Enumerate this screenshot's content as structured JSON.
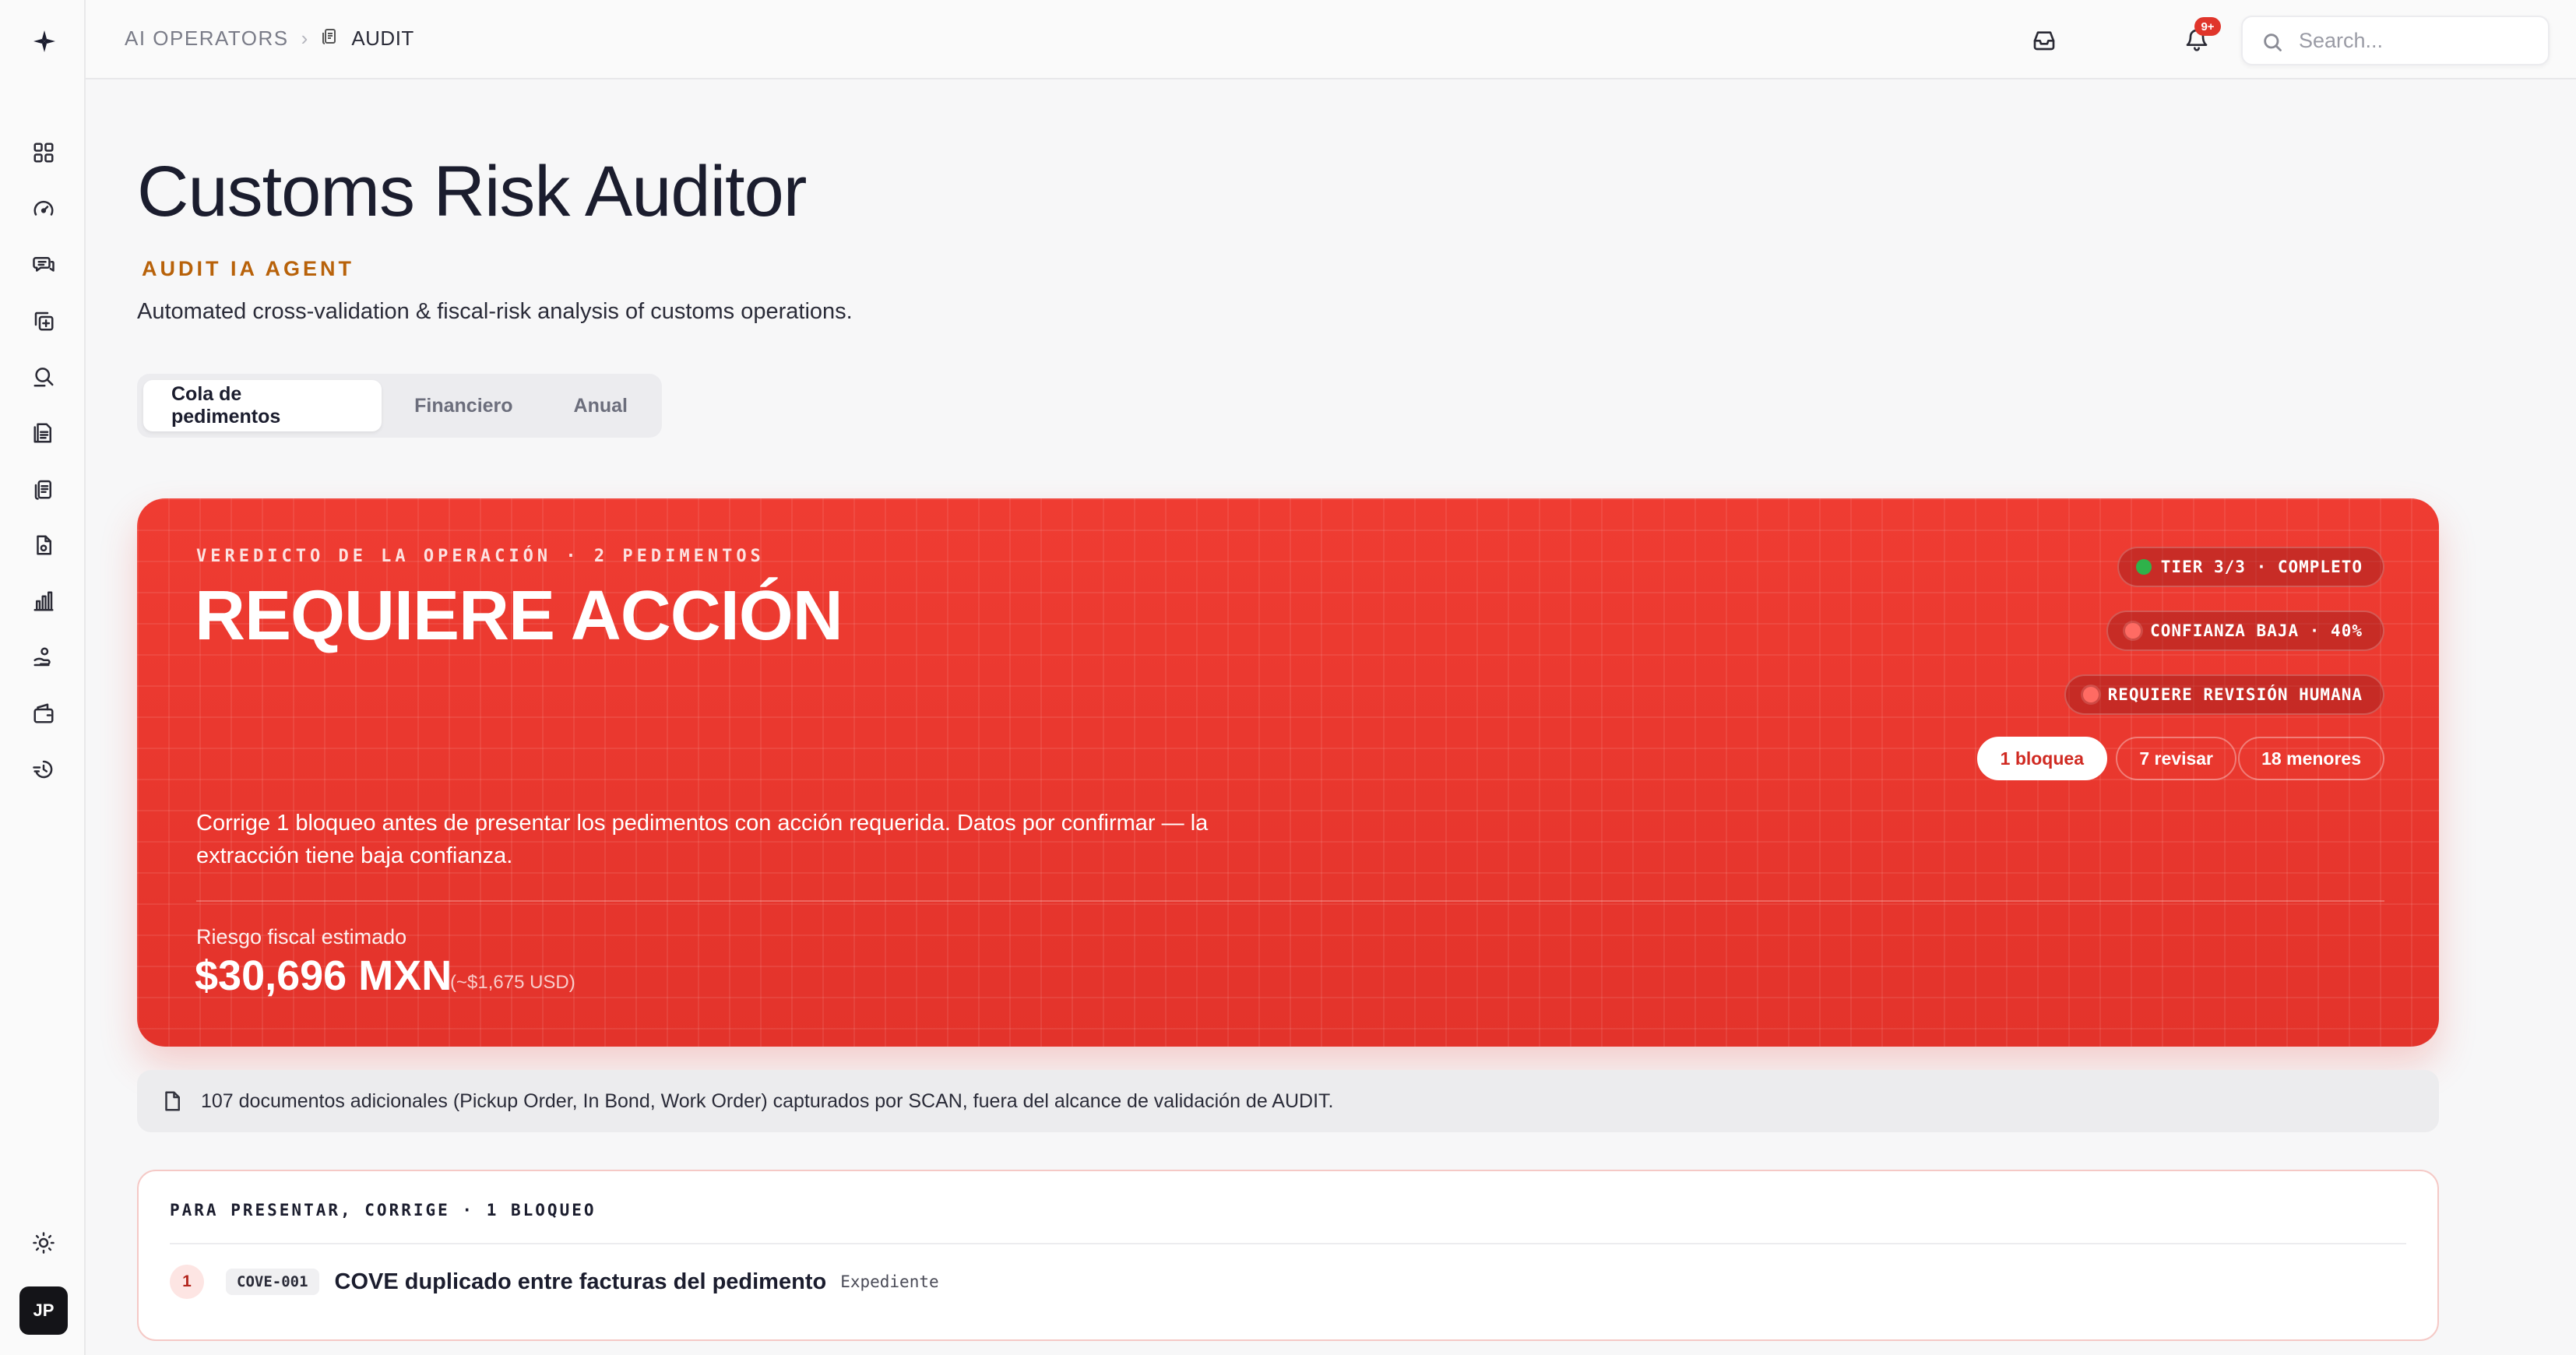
{
  "breadcrumb": {
    "root": "AI OPERATORS",
    "current": "AUDIT"
  },
  "notifications": {
    "badge": "9+"
  },
  "search": {
    "placeholder": "Search..."
  },
  "sidebar": {
    "icons": [
      "dashboard-icon",
      "gauge-icon",
      "chat-icon",
      "copy-plus-icon",
      "search-review-icon",
      "document-icon",
      "clipboard-icon",
      "file-check-icon",
      "bar-chart-icon",
      "hand-coin-icon",
      "wallet-icon",
      "history-icon"
    ],
    "user_initials": "JP"
  },
  "header": {
    "title": "Customs Risk Auditor",
    "subtitle": "AUDIT IA AGENT",
    "description": "Automated cross-validation & fiscal-risk analysis of customs operations."
  },
  "tabs": [
    {
      "label": "Cola de pedimentos",
      "active": true
    },
    {
      "label": "Financiero",
      "active": false
    },
    {
      "label": "Anual",
      "active": false
    }
  ],
  "verdict": {
    "eyebrow": "VEREDICTO DE LA OPERACIÓN · 2 PEDIMENTOS",
    "title": "REQUIERE ACCIÓN",
    "pills": [
      "TIER 3/3 · COMPLETO",
      "CONFIANZA BAJA · 40%",
      "REQUIERE REVISIÓN HUMANA"
    ],
    "counts": [
      "1 bloquea",
      "7 revisar",
      "18 menores"
    ],
    "summary": "Corrige 1 bloqueo antes de presentar los pedimentos con acción requerida. Datos por confirmar — la extracción tiene baja confianza.",
    "risk_label": "Riesgo fiscal estimado",
    "risk_amount": "$30,696 MXN",
    "risk_usd": "(~$1,675 USD)",
    "colors": {
      "card": "#e8352c",
      "ok_dot": "#2fb24a",
      "alert_dot": "#ff6b63"
    }
  },
  "info": {
    "text": "107 documentos adicionales (Pickup Order, In Bond, Work Order) capturados por SCAN, fuera del alcance de validación de AUDIT."
  },
  "blockers": {
    "heading": "PARA PRESENTAR, CORRIGE · 1 BLOQUEO",
    "items": [
      {
        "num": "1",
        "code": "COVE-001",
        "title": "COVE duplicado entre facturas del pedimento",
        "tag": "Expediente"
      }
    ]
  }
}
